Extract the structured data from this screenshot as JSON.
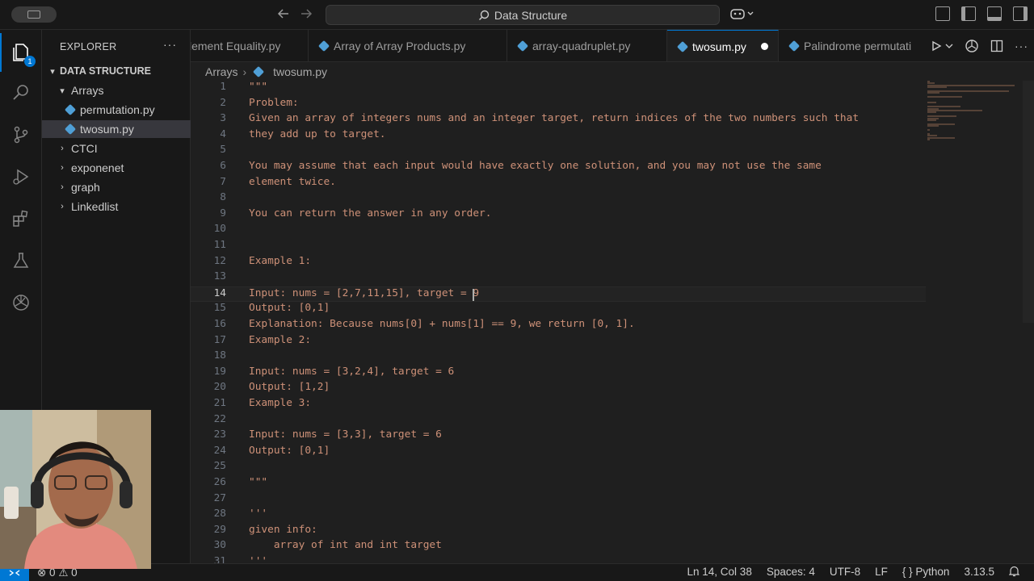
{
  "titlebar": {
    "back_icon": "arrow-left-icon",
    "forward_icon": "arrow-right-icon",
    "search_label": "Data Structure"
  },
  "activity": {
    "badge": "1"
  },
  "sidebar": {
    "title": "EXPLORER",
    "more": "···",
    "root": "DATA STRUCTURE",
    "items": [
      {
        "label": "Arrays",
        "kind": "folder-open"
      },
      {
        "label": "permutation.py",
        "kind": "file"
      },
      {
        "label": "twosum.py",
        "kind": "file",
        "selected": true
      },
      {
        "label": "CTCI",
        "kind": "folder"
      },
      {
        "label": "exponenet",
        "kind": "folder"
      },
      {
        "label": "graph",
        "kind": "folder"
      },
      {
        "label": "Linkedlist",
        "kind": "folder"
      }
    ]
  },
  "tabs": [
    {
      "label": "lement Equality.py"
    },
    {
      "label": "Array of Array Products.py"
    },
    {
      "label": "array-quadruplet.py"
    },
    {
      "label": "twosum.py",
      "active": true
    },
    {
      "label": "Palindrome permutati"
    }
  ],
  "breadcrumb": {
    "folder": "Arrays",
    "file": "twosum.py"
  },
  "editor": {
    "current_line": 14,
    "lines": [
      "\"\"\"",
      "Problem:",
      "Given an array of integers nums and an integer target, return indices of the two numbers such that",
      "they add up to target.",
      "",
      "You may assume that each input would have exactly one solution, and you may not use the same",
      "element twice.",
      "",
      "You can return the answer in any order.",
      "",
      "",
      "Example 1:",
      "",
      "Input: nums = [2,7,11,15], target = 9",
      "Output: [0,1]",
      "Explanation: Because nums[0] + nums[1] == 9, we return [0, 1].",
      "Example 2:",
      "",
      "Input: nums = [3,2,4], target = 6",
      "Output: [1,2]",
      "Example 3:",
      "",
      "Input: nums = [3,3], target = 6",
      "Output: [0,1]",
      "",
      "\"\"\"",
      "",
      "'''",
      "given info:",
      "    array of int and int target",
      "'''"
    ]
  },
  "statusbar": {
    "left": "⊗ 0 ⚠ 0",
    "position": "Ln 14, Col 38",
    "spaces": "Spaces: 4",
    "encoding": "UTF-8",
    "eol": "LF",
    "language": "{ } Python",
    "version": "3.13.5"
  }
}
